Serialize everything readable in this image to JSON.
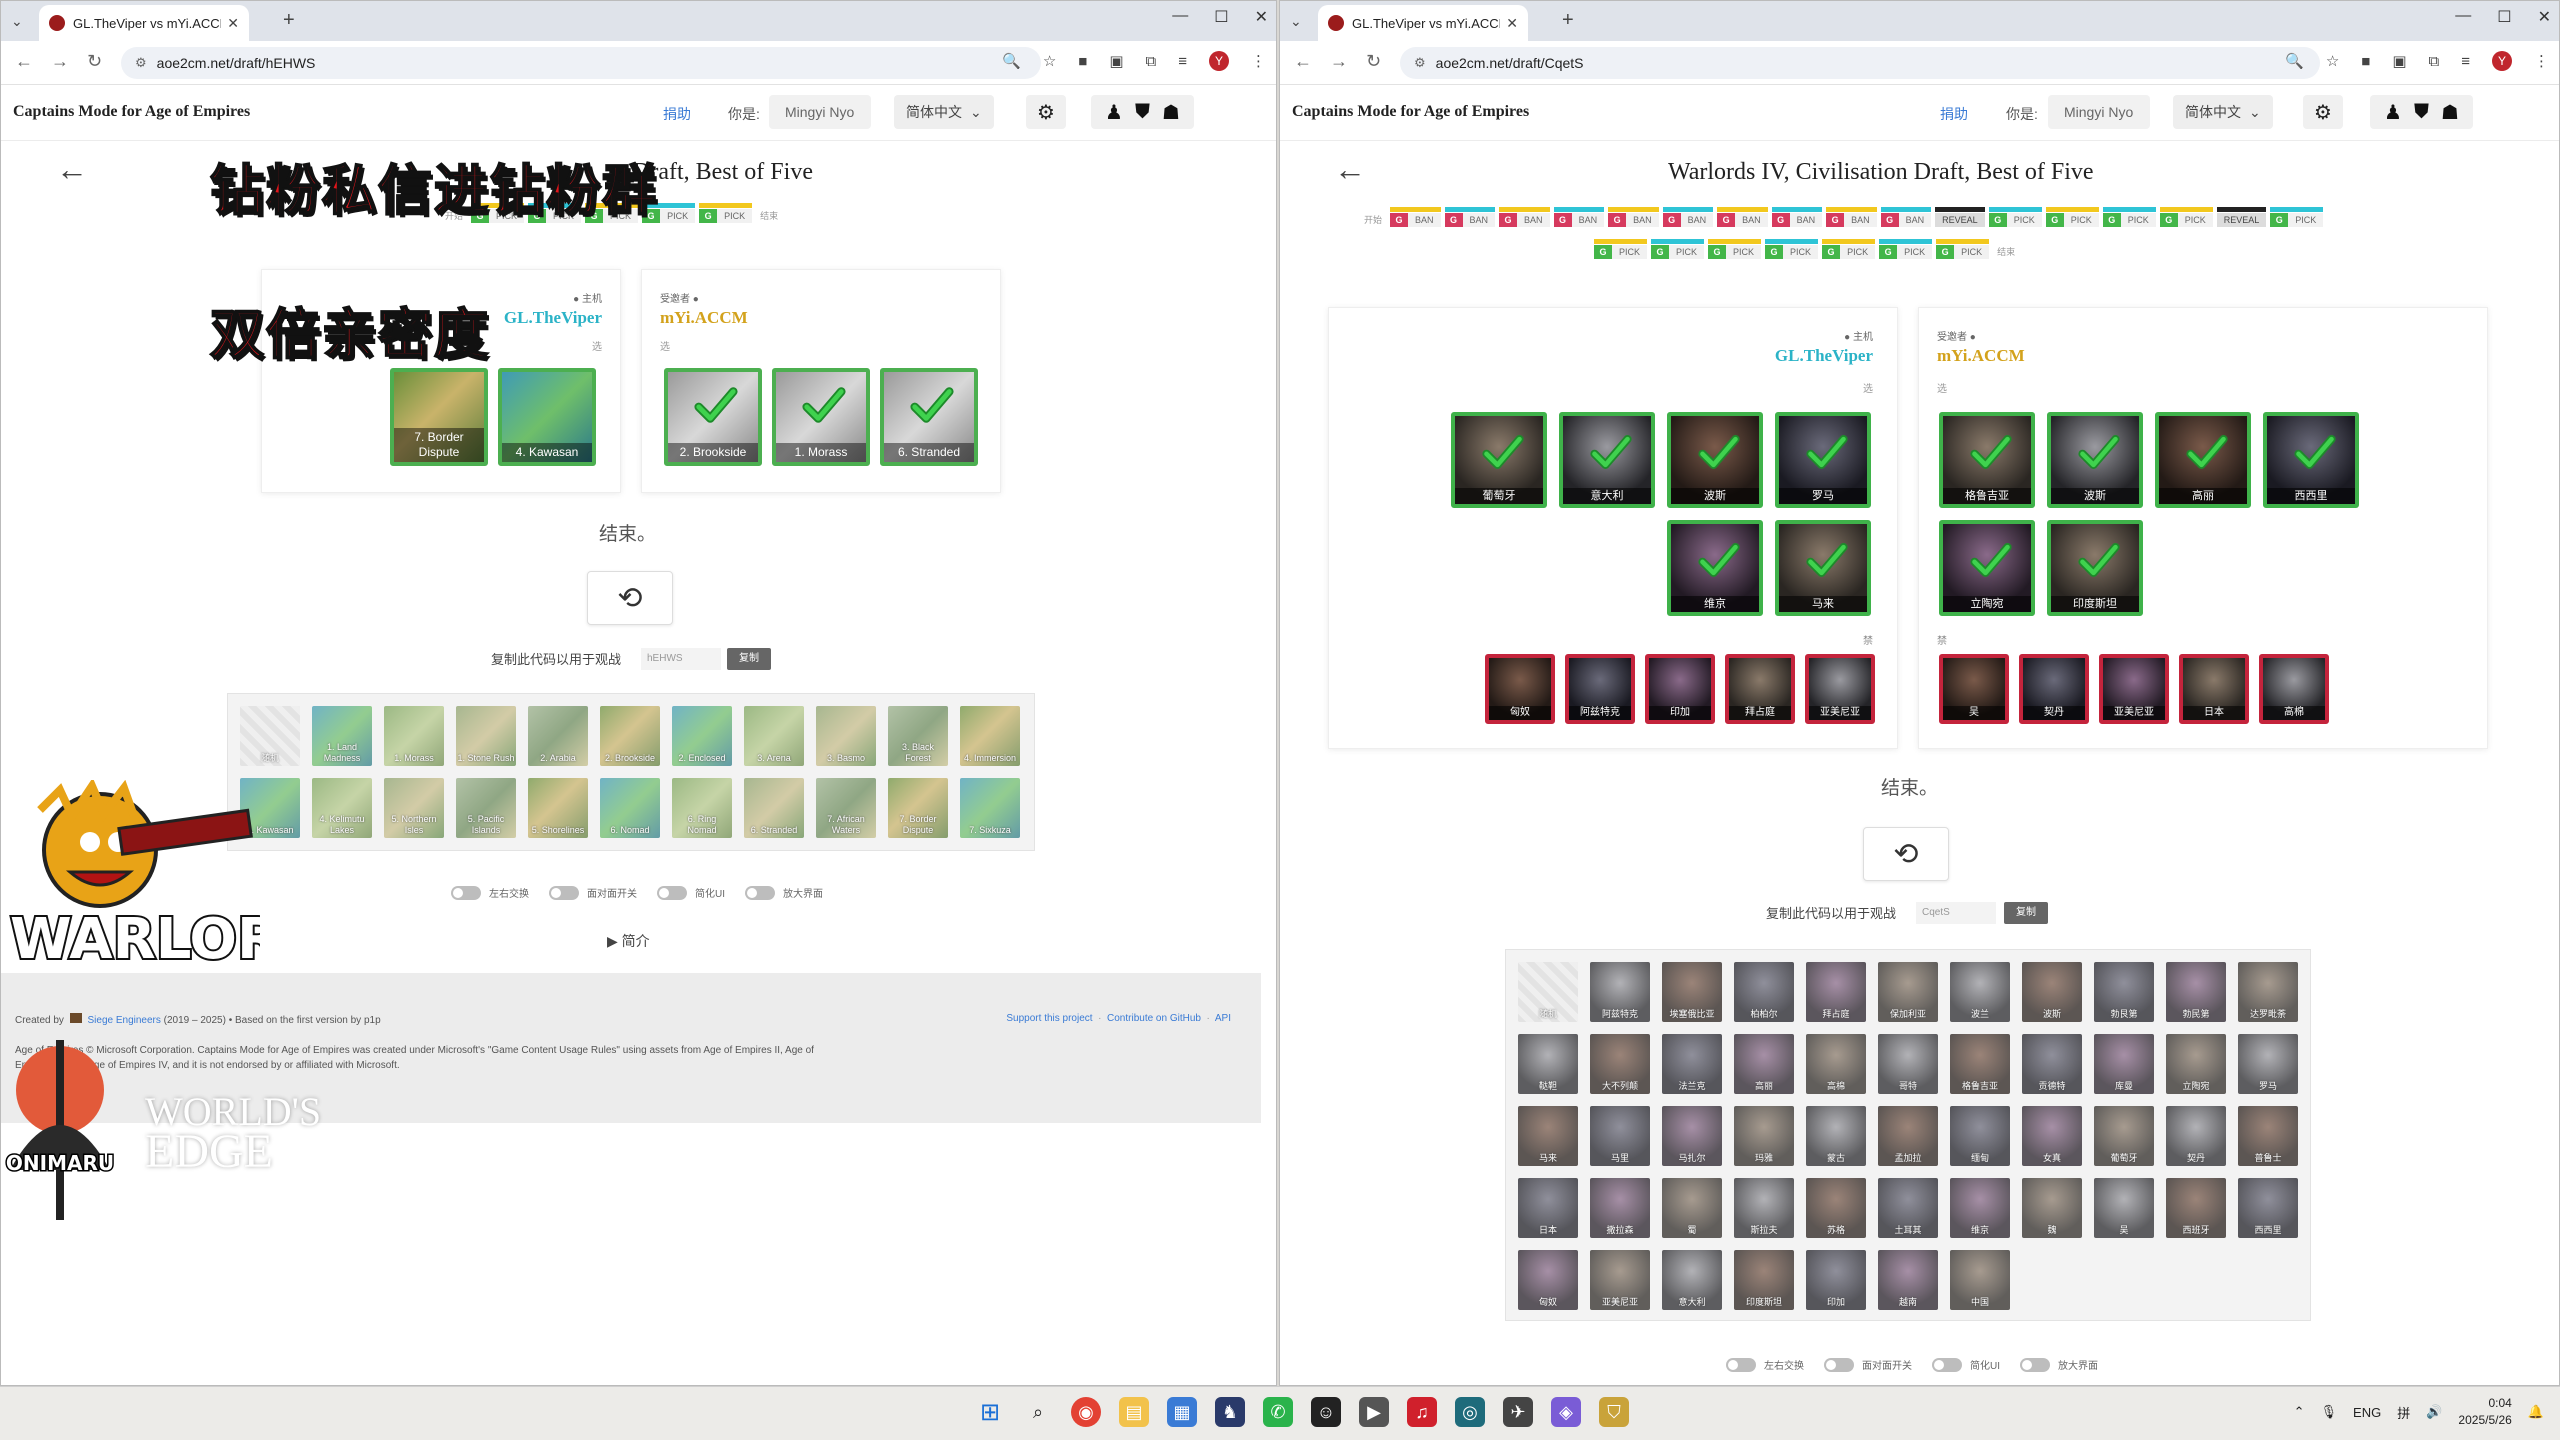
{
  "left": {
    "tab_title": "GL.TheViper vs mYi.ACCM –",
    "url": "aoe2cm.net/draft/hEHWS",
    "brand": "Captains Mode for Age of Empires",
    "donate": "捐助",
    "you_are": "你是:",
    "name_placeholder": "Mingyi Nyo",
    "language": "简体中文",
    "title": "Draft, Best of Five",
    "timeline_start": "开始",
    "timeline_end": "结束",
    "timeline": [
      {
        "g": "G",
        "t": "PICK",
        "bar": "#f2c81e"
      },
      {
        "g": "G",
        "t": "PICK",
        "bar": "#2ec4d6"
      },
      {
        "g": "G",
        "t": "PICK",
        "bar": "#f2c81e"
      },
      {
        "g": "G",
        "t": "PICK",
        "bar": "#2ec4d6"
      },
      {
        "g": "G",
        "t": "PICK",
        "bar": "#f2c81e"
      }
    ],
    "host_role": "● 主机",
    "host_name": "GL.TheViper",
    "host_sub": "选",
    "guest_role": "受邀者 ●",
    "guest_name": "mYi.ACCM",
    "guest_sub": "选",
    "host_maps": [
      "7. Border Dispute",
      "4. Kawasan"
    ],
    "guest_maps": [
      "2. Brookside",
      "1. Morass",
      "6. Stranded"
    ],
    "finished": "结束。",
    "spectate_label": "复制此代码以用于观战",
    "spectate_code": "hEHWS",
    "copy": "复制",
    "pool": [
      "随机",
      "1. Land Madness",
      "1. Morass",
      "1. Stone Rush",
      "2. Arabia",
      "2. Brookside",
      "2. Enclosed",
      "3. Arena",
      "3. Basmo",
      "3. Black Forest",
      "4. Immersion",
      "4. Kawasan",
      "4. Kelimutu Lakes",
      "5. Northern Isles",
      "5. Pacific Islands",
      "5. Shorelines",
      "6. Nomad",
      "6. Ring Nomad",
      "6. Stranded",
      "7. African Waters",
      "7. Border Dispute",
      "7. Sixkuza"
    ],
    "toggles": [
      "左右交换",
      "面对面开关",
      "简化UI",
      "放大界面"
    ],
    "intro": "▶ 简介",
    "footer_created": "Created by",
    "footer_org": "Siege Engineers",
    "footer_years": "(2019 – 2025) • Based on the first version by p1p",
    "footer_legal": "Age of Empires © Microsoft Corporation. Captains Mode for Age of Empires was created under Microsoft's \"Game Content Usage Rules\" using assets from Age of Empires II, Age of Empires III, and Age of Empires IV, and it is not endorsed by or affiliated with Microsoft.",
    "footer_support": "Support this project",
    "footer_github": "Contribute on GitHub",
    "footer_api": "API"
  },
  "right": {
    "tab_title": "GL.TheViper vs mYi.ACCM –",
    "url": "aoe2cm.net/draft/CqetS",
    "brand": "Captains Mode for Age of Empires",
    "donate": "捐助",
    "you_are": "你是:",
    "name_placeholder": "Mingyi Nyo",
    "language": "简体中文",
    "title": "Warlords IV, Civilisation Draft, Best of Five",
    "timeline_start": "开始",
    "timeline_end": "结束",
    "timeline_row1": [
      {
        "g": "G",
        "t": "BAN",
        "bar": "#f2c81e",
        "gc": "#d63a5e"
      },
      {
        "g": "G",
        "t": "BAN",
        "bar": "#2ec4d6",
        "gc": "#d63a5e"
      },
      {
        "g": "G",
        "t": "BAN",
        "bar": "#f2c81e",
        "gc": "#d63a5e"
      },
      {
        "g": "G",
        "t": "BAN",
        "bar": "#2ec4d6",
        "gc": "#d63a5e"
      },
      {
        "g": "G",
        "t": "BAN",
        "bar": "#f2c81e",
        "gc": "#d63a5e"
      },
      {
        "g": "G",
        "t": "BAN",
        "bar": "#2ec4d6",
        "gc": "#d63a5e"
      },
      {
        "g": "G",
        "t": "BAN",
        "bar": "#f2c81e",
        "gc": "#d63a5e"
      },
      {
        "g": "G",
        "t": "BAN",
        "bar": "#2ec4d6",
        "gc": "#d63a5e"
      },
      {
        "g": "G",
        "t": "BAN",
        "bar": "#f2c81e",
        "gc": "#d63a5e"
      },
      {
        "g": "G",
        "t": "BAN",
        "bar": "#2ec4d6",
        "gc": "#d63a5e"
      },
      {
        "g": "",
        "t": "REVEAL",
        "bar": "#222222",
        "gc": "#d63a5e",
        "reveal": true
      },
      {
        "g": "G",
        "t": "PICK",
        "bar": "#2ec4d6",
        "gc": "#43b649"
      },
      {
        "g": "G",
        "t": "PICK",
        "bar": "#f2c81e",
        "gc": "#43b649"
      },
      {
        "g": "G",
        "t": "PICK",
        "bar": "#2ec4d6",
        "gc": "#43b649"
      },
      {
        "g": "G",
        "t": "PICK",
        "bar": "#f2c81e",
        "gc": "#43b649"
      },
      {
        "g": "",
        "t": "REVEAL",
        "bar": "#222222",
        "gc": "#43b649",
        "reveal": true
      },
      {
        "g": "G",
        "t": "PICK",
        "bar": "#2ec4d6",
        "gc": "#43b649"
      }
    ],
    "timeline_row2": [
      {
        "g": "G",
        "t": "PICK",
        "bar": "#f2c81e",
        "gc": "#43b649"
      },
      {
        "g": "G",
        "t": "PICK",
        "bar": "#2ec4d6",
        "gc": "#43b649"
      },
      {
        "g": "G",
        "t": "PICK",
        "bar": "#f2c81e",
        "gc": "#43b649"
      },
      {
        "g": "G",
        "t": "PICK",
        "bar": "#2ec4d6",
        "gc": "#43b649"
      },
      {
        "g": "G",
        "t": "PICK",
        "bar": "#f2c81e",
        "gc": "#43b649"
      },
      {
        "g": "G",
        "t": "PICK",
        "bar": "#2ec4d6",
        "gc": "#43b649"
      },
      {
        "g": "G",
        "t": "PICK",
        "bar": "#f2c81e",
        "gc": "#43b649"
      }
    ],
    "host_role": "● 主机",
    "host_name": "GL.TheViper",
    "host_sub": "选",
    "guest_role": "受邀者 ●",
    "guest_name": "mYi.ACCM",
    "guest_sub": "选",
    "ban_label": "禁",
    "host_picks": [
      "葡萄牙",
      "意大利",
      "波斯",
      "罗马",
      "维京",
      "马来"
    ],
    "guest_picks": [
      "格鲁吉亚",
      "波斯",
      "高丽",
      "西西里",
      "立陶宛",
      "印度斯坦"
    ],
    "host_bans": [
      "匈奴",
      "阿兹特克",
      "印加",
      "拜占庭",
      "亚美尼亚"
    ],
    "guest_bans": [
      "吴",
      "契丹",
      "亚美尼亚",
      "日本",
      "高棉"
    ],
    "finished": "结束。",
    "spectate_label": "复制此代码以用于观战",
    "spectate_code": "CqetS",
    "copy": "复制",
    "pool": [
      "随机",
      "阿兹特克",
      "埃塞俄比亚",
      "柏柏尔",
      "拜占庭",
      "保加利亚",
      "波兰",
      "波斯",
      "勃艮第",
      "勃民第",
      "达罗毗荼",
      "鞑靼",
      "大不列颠",
      "法兰克",
      "高丽",
      "高棉",
      "哥特",
      "格鲁吉亚",
      "贡德特",
      "库曼",
      "立陶宛",
      "罗马",
      "马来",
      "马里",
      "马扎尔",
      "玛雅",
      "蒙古",
      "孟加拉",
      "缅甸",
      "女真",
      "葡萄牙",
      "契丹",
      "普鲁士",
      "日本",
      "撒拉森",
      "蜀",
      "斯拉夫",
      "苏格",
      "土耳其",
      "维京",
      "魏",
      "吴",
      "西班牙",
      "西西里",
      "匈奴",
      "亚美尼亚",
      "意大利",
      "印度斯坦",
      "印加",
      "越南",
      "中国"
    ],
    "toggles": [
      "左右交换",
      "面对面开关",
      "简化UI",
      "放大界面"
    ]
  },
  "overlay": {
    "line1": "钻粉私信进钻粉群",
    "line2": "双倍亲密度",
    "logo_text": "WARLORDS IV",
    "onimaru": "ONIMARU",
    "worlds_edge_1": "WORLD'S",
    "worlds_edge_2": "EDGE"
  },
  "taskbar": {
    "lang": "ENG",
    "time": "0:04",
    "date": "2025/5/26"
  }
}
